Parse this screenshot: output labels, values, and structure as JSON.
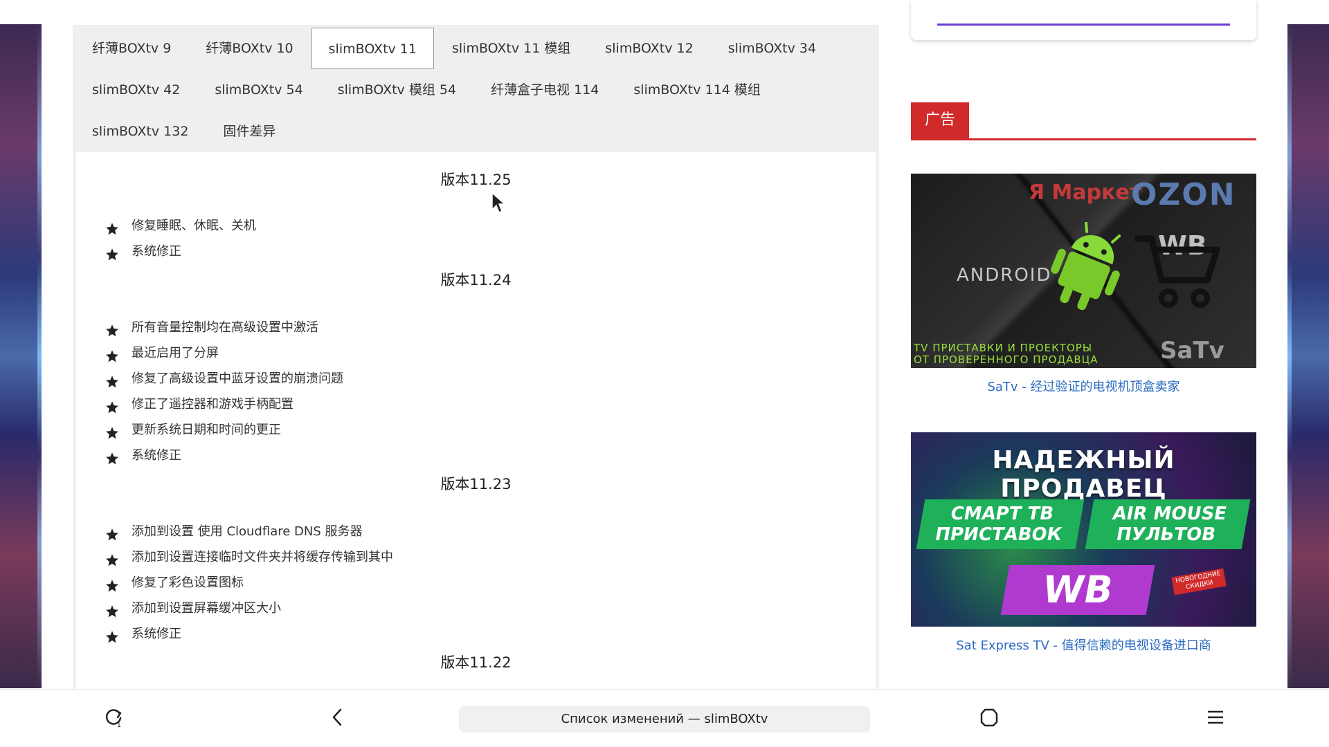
{
  "tabs": [
    {
      "label": "纤薄BOXtv 9",
      "active": false
    },
    {
      "label": "纤薄BOXtv 10",
      "active": false
    },
    {
      "label": "slimBOXtv 11",
      "active": true
    },
    {
      "label": "slimBOXtv 11 模组",
      "active": false
    },
    {
      "label": "slimBOXtv 12",
      "active": false
    },
    {
      "label": "slimBOXtv 34",
      "active": false
    },
    {
      "label": "slimBOXtv 42",
      "active": false
    },
    {
      "label": "slimBOXtv 54",
      "active": false
    },
    {
      "label": "slimBOXtv 模组 54",
      "active": false
    },
    {
      "label": "纤薄盒子电视 114",
      "active": false
    },
    {
      "label": "slimBOXtv 114 模组",
      "active": false
    },
    {
      "label": "slimBOXtv 132",
      "active": false
    },
    {
      "label": "固件差异",
      "active": false
    }
  ],
  "versions": [
    {
      "title": "版本11.25",
      "items": [
        "修复睡眠、休眠、关机",
        "系统修正"
      ]
    },
    {
      "title": "版本11.24",
      "items": [
        "所有音量控制均在高级设置中激活",
        "最近启用了分屏",
        "修复了高级设置中蓝牙设置的崩溃问题",
        "修正了遥控器和游戏手柄配置",
        "更新系统日期和时间的更正",
        "系统修正"
      ]
    },
    {
      "title": "版本11.23",
      "items": [
        "添加到设置 使用 Cloudflare DNS 服务器",
        "添加到设置连接临时文件夹并将缓存传输到其中",
        "修复了彩色设置图标",
        "添加到设置屏幕缓冲区大小",
        "系统修正"
      ]
    },
    {
      "title": "版本11.22",
      "items": []
    }
  ],
  "sidebar": {
    "ad_label": "广告",
    "ads": [
      {
        "caption": "SaTv - 经过验证的电视机顶盒卖家",
        "image_texts": {
          "market": "Я Маркет",
          "ozon": "OZON",
          "android": "ANDROID",
          "wb": "WB",
          "satv": "SaTv",
          "promo": "TV ПРИСТАВКИ И ПРОЕКТОРЫ\nОТ ПРОВЕРЕННОГО ПРОДАВЦА"
        }
      },
      {
        "caption": "Sat Express TV - 值得信赖的电视设备进口商",
        "image_texts": {
          "headline": "НАДЕЖНЫЙ ПРОДАВЕЦ",
          "box1": "СМАРТ ТВ\nПРИСТАВОК",
          "box2": "AIR MOUSE\nПУЛЬТОВ",
          "box3": "WB",
          "tag": "НОВОГОДНИЕ\nСКИДКИ"
        }
      }
    ]
  },
  "browser": {
    "page_title": "Список изменений — slimBOXtv"
  },
  "icons": {
    "refresh": "refresh-icon",
    "back": "back-arrow-icon",
    "home": "home-icon",
    "menu": "menu-icon",
    "star": "star-icon"
  },
  "colors": {
    "ad_red": "#d12a2a",
    "link_blue": "#2a6ac0",
    "tab_bg": "#efefef"
  }
}
